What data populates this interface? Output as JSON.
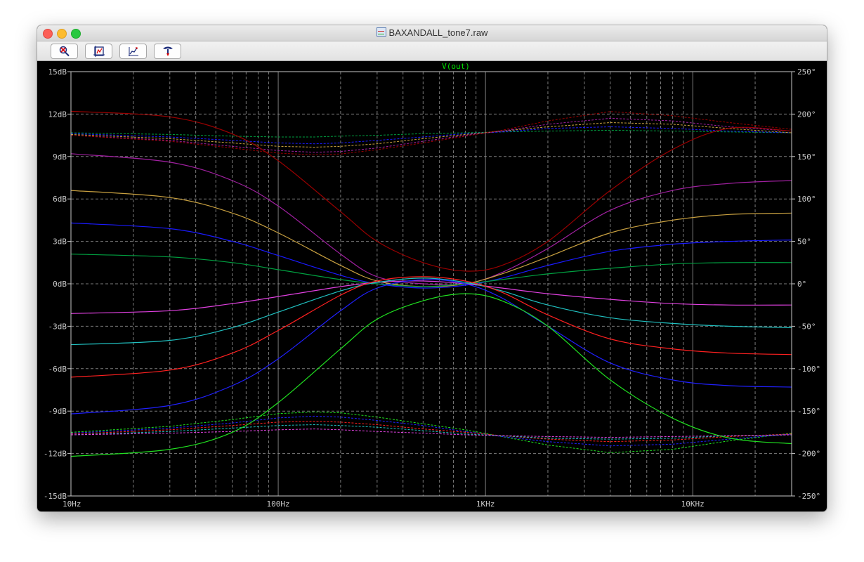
{
  "window": {
    "title": "BAXANDALL_tone7.raw"
  },
  "toolbar": {
    "buttons": [
      {
        "name": "zoom-full-extents-button",
        "icon": "magnifier-cross-icon"
      },
      {
        "name": "pan-plot-button",
        "icon": "pan-frame-icon"
      },
      {
        "name": "autorange-button",
        "icon": "autorange-icon"
      },
      {
        "name": "cursor-probe-button",
        "icon": "probe-icon"
      }
    ]
  },
  "chart_data": {
    "type": "line",
    "title": "V(out)",
    "xscale": "log",
    "xlim": [
      10,
      30000
    ],
    "ylim_left": [
      -15,
      15
    ],
    "ylim_right": [
      -250,
      250
    ],
    "x_ticks": [
      "10Hz",
      "100Hz",
      "1KHz",
      "10KHz"
    ],
    "y_left_ticks": [
      "15dB",
      "12dB",
      "9dB",
      "6dB",
      "3dB",
      "0dB",
      "-3dB",
      "-6dB",
      "-9dB",
      "-12dB",
      "-15dB"
    ],
    "y_right_ticks": [
      "250°",
      "200°",
      "150°",
      "100°",
      "50°",
      "0°",
      "-50°",
      "-100°",
      "-150°",
      "-200°",
      "-250°"
    ],
    "grid": true,
    "background": "#000000",
    "axis_color": "#c8c8c8",
    "title_color": "#00e000",
    "magnitude_series": [
      {
        "color": "#990000",
        "x": [
          10,
          30,
          60,
          100,
          200,
          300,
          500,
          800,
          1200,
          2000,
          4000,
          8000,
          15000,
          30000
        ],
        "y": [
          12.2,
          11.8,
          10.6,
          8.7,
          5.1,
          3.0,
          1.5,
          0.9,
          1.3,
          3.0,
          6.6,
          9.5,
          11.0,
          10.8
        ]
      },
      {
        "color": "#a020a0",
        "x": [
          10,
          30,
          60,
          100,
          200,
          300,
          500,
          800,
          1200,
          2000,
          4000,
          8000,
          15000,
          30000
        ],
        "y": [
          9.2,
          8.6,
          7.3,
          5.5,
          2.1,
          0.5,
          0.0,
          0.0,
          0.8,
          2.5,
          5.2,
          6.6,
          7.1,
          7.3
        ]
      },
      {
        "color": "#c8a040",
        "x": [
          10,
          30,
          60,
          100,
          200,
          300,
          500,
          800,
          1200,
          2000,
          4000,
          8000,
          15000,
          30000
        ],
        "y": [
          6.6,
          6.1,
          5.0,
          3.6,
          1.3,
          0.2,
          -0.2,
          0.0,
          0.7,
          1.9,
          3.6,
          4.5,
          4.9,
          5.0
        ]
      },
      {
        "color": "#1a1aff",
        "x": [
          10,
          30,
          60,
          100,
          200,
          300,
          500,
          800,
          1200,
          2000,
          4000,
          8000,
          15000,
          30000
        ],
        "y": [
          4.3,
          3.9,
          3.0,
          2.0,
          0.6,
          0.0,
          -0.3,
          -0.1,
          0.4,
          1.3,
          2.3,
          2.8,
          3.0,
          3.1
        ]
      },
      {
        "color": "#00a040",
        "x": [
          10,
          30,
          60,
          100,
          200,
          300,
          500,
          800,
          1200,
          2000,
          4000,
          8000,
          15000,
          30000
        ],
        "y": [
          2.1,
          1.9,
          1.5,
          1.0,
          0.3,
          0.0,
          -0.2,
          0.0,
          0.3,
          0.7,
          1.1,
          1.4,
          1.5,
          1.5
        ]
      },
      {
        "color": "#e040e0",
        "x": [
          10,
          30,
          60,
          100,
          200,
          300,
          500,
          800,
          1200,
          2000,
          4000,
          8000,
          15000,
          30000
        ],
        "y": [
          -2.1,
          -1.9,
          -1.4,
          -0.9,
          -0.2,
          0.1,
          0.2,
          0.0,
          -0.3,
          -0.7,
          -1.1,
          -1.4,
          -1.5,
          -1.5
        ]
      },
      {
        "color": "#20c0c0",
        "x": [
          10,
          30,
          60,
          100,
          200,
          300,
          500,
          800,
          1200,
          2000,
          4000,
          8000,
          15000,
          30000
        ],
        "y": [
          -4.3,
          -4.0,
          -3.1,
          -2.0,
          -0.5,
          0.1,
          0.4,
          0.1,
          -0.5,
          -1.5,
          -2.4,
          -2.8,
          -3.0,
          -3.1
        ]
      },
      {
        "color": "#ff2020",
        "x": [
          10,
          30,
          60,
          100,
          200,
          300,
          500,
          800,
          1200,
          2000,
          4000,
          8000,
          15000,
          30000
        ],
        "y": [
          -6.6,
          -6.1,
          -4.9,
          -3.3,
          -0.8,
          0.2,
          0.5,
          0.2,
          -0.6,
          -2.2,
          -3.9,
          -4.6,
          -4.9,
          -5.0
        ]
      },
      {
        "color": "#2020ff",
        "x": [
          10,
          30,
          60,
          100,
          200,
          300,
          500,
          800,
          1200,
          2000,
          4000,
          8000,
          15000,
          30000
        ],
        "y": [
          -9.2,
          -8.6,
          -7.2,
          -5.3,
          -1.9,
          -0.3,
          0.3,
          0.0,
          -1.0,
          -3.0,
          -5.6,
          -6.8,
          -7.2,
          -7.3
        ]
      },
      {
        "color": "#20e020",
        "x": [
          10,
          30,
          60,
          100,
          200,
          300,
          500,
          800,
          1200,
          2000,
          4000,
          8000,
          15000,
          30000
        ],
        "y": [
          -12.2,
          -11.7,
          -10.5,
          -8.4,
          -4.6,
          -2.5,
          -1.2,
          -0.7,
          -1.2,
          -3.0,
          -6.8,
          -9.5,
          -10.9,
          -11.3
        ]
      }
    ],
    "phase_series": [
      {
        "color": "#20e020",
        "x": [
          10,
          30,
          60,
          100,
          150,
          200,
          300,
          500,
          800,
          1200,
          2000,
          4000,
          8000,
          15000,
          30000
        ],
        "y": [
          -175,
          -168,
          -160,
          -153,
          -151,
          -152,
          -157,
          -165,
          -172,
          -180,
          -190,
          -199,
          -195,
          -185,
          -176
        ]
      },
      {
        "color": "#2020ff",
        "x": [
          10,
          30,
          60,
          100,
          150,
          200,
          300,
          500,
          800,
          1200,
          2000,
          4000,
          8000,
          15000,
          30000
        ],
        "y": [
          -176,
          -170,
          -164,
          -158,
          -156,
          -157,
          -161,
          -167,
          -174,
          -180,
          -186,
          -191,
          -189,
          -183,
          -177
        ]
      },
      {
        "color": "#ff2020",
        "x": [
          10,
          30,
          60,
          100,
          150,
          200,
          300,
          500,
          800,
          1200,
          2000,
          4000,
          8000,
          15000,
          30000
        ],
        "y": [
          -177,
          -172,
          -167,
          -163,
          -162,
          -163,
          -166,
          -171,
          -175,
          -179,
          -183,
          -186,
          -184,
          -180,
          -177
        ]
      },
      {
        "color": "#20c0c0",
        "x": [
          10,
          30,
          60,
          100,
          150,
          200,
          300,
          500,
          800,
          1200,
          2000,
          4000,
          8000,
          15000,
          30000
        ],
        "y": [
          -178,
          -174,
          -170,
          -167,
          -166,
          -167,
          -169,
          -173,
          -177,
          -179,
          -182,
          -183,
          -182,
          -179,
          -178
        ]
      },
      {
        "color": "#e040e0",
        "x": [
          10,
          30,
          60,
          100,
          150,
          200,
          300,
          500,
          800,
          1200,
          2000,
          4000,
          8000,
          15000,
          30000
        ],
        "y": [
          -178,
          -176,
          -174,
          -172,
          -171,
          -172,
          -174,
          -176,
          -178,
          -179,
          -180,
          -181,
          -180,
          -179,
          -178
        ]
      },
      {
        "color": "#00a040",
        "x": [
          10,
          30,
          60,
          100,
          150,
          200,
          300,
          500,
          800,
          1200,
          2000,
          4000,
          8000,
          15000,
          30000
        ],
        "y": [
          178,
          176,
          174,
          173,
          173,
          174,
          175,
          177,
          178,
          179,
          180,
          181,
          180,
          179,
          178
        ]
      },
      {
        "color": "#1a1aff",
        "x": [
          10,
          30,
          60,
          100,
          150,
          200,
          300,
          500,
          800,
          1200,
          2000,
          4000,
          8000,
          15000,
          30000
        ],
        "y": [
          177,
          173,
          169,
          166,
          165,
          166,
          169,
          173,
          177,
          179,
          183,
          185,
          183,
          180,
          178
        ]
      },
      {
        "color": "#c8a040",
        "x": [
          10,
          30,
          60,
          100,
          150,
          200,
          300,
          500,
          800,
          1200,
          2000,
          4000,
          8000,
          15000,
          30000
        ],
        "y": [
          176,
          171,
          166,
          162,
          161,
          162,
          165,
          171,
          176,
          180,
          185,
          190,
          188,
          183,
          178
        ]
      },
      {
        "color": "#a020a0",
        "x": [
          10,
          30,
          60,
          100,
          150,
          200,
          300,
          500,
          800,
          1200,
          2000,
          4000,
          8000,
          15000,
          30000
        ],
        "y": [
          175,
          169,
          162,
          157,
          155,
          156,
          160,
          168,
          175,
          180,
          188,
          195,
          192,
          185,
          180
        ]
      },
      {
        "color": "#990000",
        "x": [
          10,
          30,
          60,
          100,
          150,
          200,
          300,
          500,
          800,
          1200,
          2000,
          4000,
          8000,
          15000,
          30000
        ],
        "y": [
          175,
          168,
          160,
          154,
          152,
          153,
          158,
          166,
          174,
          181,
          192,
          203,
          198,
          190,
          182
        ]
      }
    ]
  }
}
